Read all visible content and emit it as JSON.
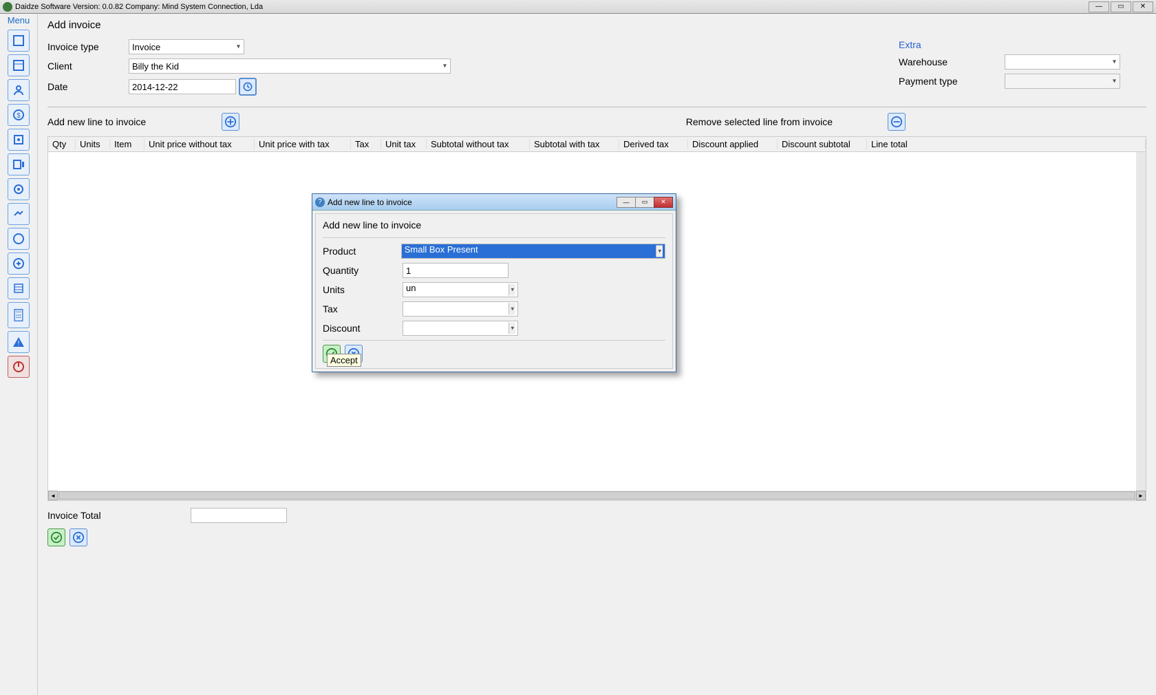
{
  "window": {
    "title": "Daidze Software Version: 0.0.82 Company: Mind System Connection, Lda"
  },
  "sidebar": {
    "menu_label": "Menu"
  },
  "page": {
    "title": "Add invoice",
    "invoice_type_label": "Invoice type",
    "invoice_type_value": "Invoice",
    "client_label": "Client",
    "client_value": "Billy the Kid",
    "date_label": "Date",
    "date_value": "2014-12-22",
    "extra_label": "Extra",
    "warehouse_label": "Warehouse",
    "warehouse_value": "",
    "payment_label": "Payment type",
    "payment_value": "",
    "add_line_label": "Add new line to invoice",
    "remove_line_label": "Remove selected line from invoice",
    "invoice_total_label": "Invoice Total",
    "invoice_total_value": ""
  },
  "columns": [
    "Qty",
    "Units",
    "Item",
    "Unit price without tax",
    "Unit price with tax",
    "Tax",
    "Unit tax",
    "Subtotal without tax",
    "Subtotal with tax",
    "Derived tax",
    "Discount applied",
    "Discount subtotal",
    "Line total"
  ],
  "dialog": {
    "title": "Add new line to invoice",
    "section_title": "Add new line to invoice",
    "product_label": "Product",
    "product_value": "Small Box Present",
    "quantity_label": "Quantity",
    "quantity_value": "1",
    "units_label": "Units",
    "units_value": "un",
    "tax_label": "Tax",
    "tax_value": "",
    "discount_label": "Discount",
    "discount_value": "",
    "accept_tooltip": "Accept"
  }
}
